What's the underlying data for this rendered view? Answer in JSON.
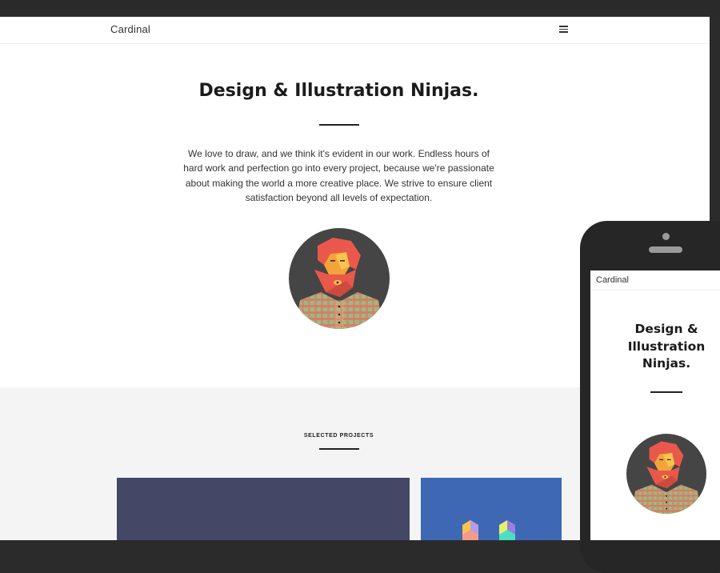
{
  "site": {
    "logo": "Cardinal",
    "menu_icon": "hamburger-menu-icon"
  },
  "hero": {
    "title": "Design & Illustration Ninjas.",
    "body": "We love to draw, and we think it's evident in our work. Endless hours of hard work and perfection go into every project, because we're passionate about making the world a more creative place. We strive to ensure client satisfaction beyond all levels of expectation.",
    "avatar_icon": "bearded-man-avatar-icon"
  },
  "projects": {
    "label": "SELECTED PROJECTS",
    "cards": [
      {
        "color": "#444766"
      },
      {
        "color": "#3e68b4",
        "icon": "isometric-letter-icon"
      }
    ]
  },
  "mobile": {
    "logo": "Cardinal",
    "title": "Design & Illustration Ninjas."
  },
  "colors": {
    "frame": "#262626",
    "accent": "#e9584a",
    "section_bg": "#f4f4f4"
  }
}
